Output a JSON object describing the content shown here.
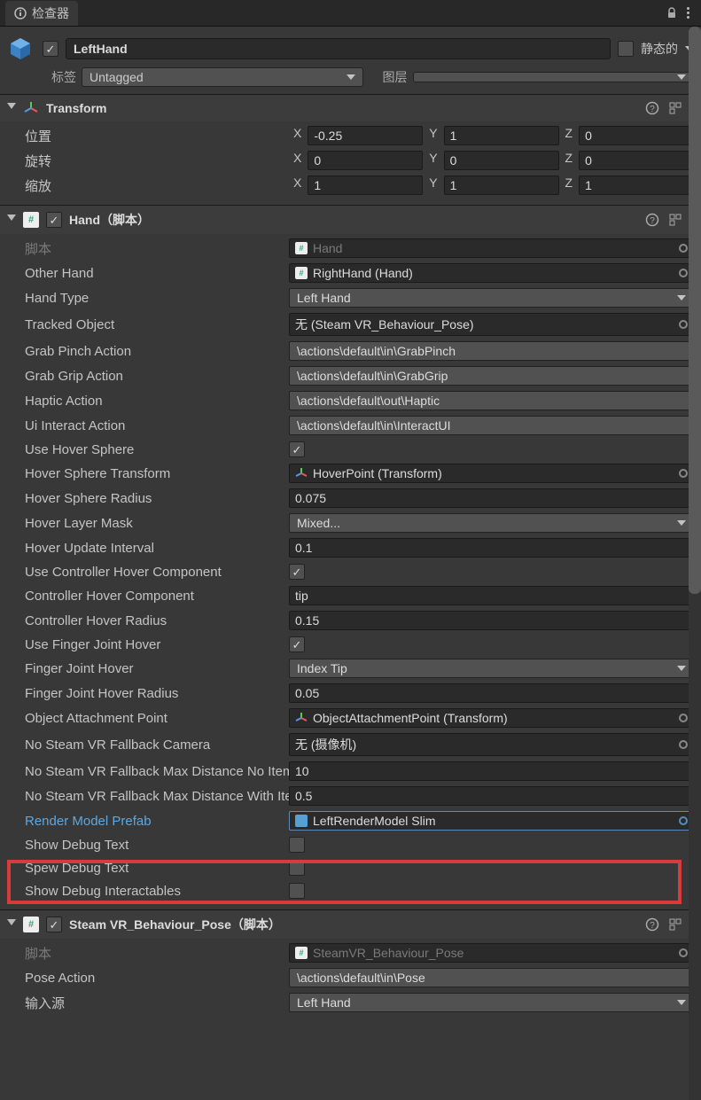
{
  "tab": {
    "title": "检查器"
  },
  "header": {
    "name": "LeftHand",
    "static_label": "静态的"
  },
  "tag_row": {
    "tag_label": "标签",
    "tag_value": "Untagged",
    "layer_label": "图层",
    "layer_value": ""
  },
  "transform": {
    "title": "Transform",
    "position_label": "位置",
    "rotation_label": "旋转",
    "scale_label": "缩放",
    "pos": {
      "x": "-0.25",
      "y": "1",
      "z": "0"
    },
    "rot": {
      "x": "0",
      "y": "0",
      "z": "0"
    },
    "scale": {
      "x": "1",
      "y": "1",
      "z": "1"
    },
    "axis": {
      "x": "X",
      "y": "Y",
      "z": "Z"
    }
  },
  "hand": {
    "title": "Hand（脚本）",
    "script_label": "脚本",
    "script_value": "Hand",
    "other_hand_label": "Other Hand",
    "other_hand_value": "RightHand (Hand)",
    "hand_type_label": "Hand Type",
    "hand_type_value": "Left Hand",
    "tracked_object_label": "Tracked Object",
    "tracked_object_value": "无 (Steam VR_Behaviour_Pose)",
    "grab_pinch_label": "Grab Pinch Action",
    "grab_pinch_value": "\\actions\\default\\in\\GrabPinch",
    "grab_grip_label": "Grab Grip Action",
    "grab_grip_value": "\\actions\\default\\in\\GrabGrip",
    "haptic_label": "Haptic Action",
    "haptic_value": "\\actions\\default\\out\\Haptic",
    "ui_interact_label": "Ui Interact Action",
    "ui_interact_value": "\\actions\\default\\in\\InteractUI",
    "use_hover_sphere_label": "Use Hover Sphere",
    "hover_sphere_transform_label": "Hover Sphere Transform",
    "hover_sphere_transform_value": "HoverPoint (Transform)",
    "hover_sphere_radius_label": "Hover Sphere Radius",
    "hover_sphere_radius_value": "0.075",
    "hover_layer_mask_label": "Hover Layer Mask",
    "hover_layer_mask_value": "Mixed...",
    "hover_update_interval_label": "Hover Update Interval",
    "hover_update_interval_value": "0.1",
    "use_controller_hover_label": "Use Controller Hover Component",
    "controller_hover_comp_label": "Controller Hover Component",
    "controller_hover_comp_value": "tip",
    "controller_hover_radius_label": "Controller Hover Radius",
    "controller_hover_radius_value": "0.15",
    "use_finger_joint_hover_label": "Use Finger Joint Hover",
    "finger_joint_hover_label": "Finger Joint Hover",
    "finger_joint_hover_value": "Index Tip",
    "finger_joint_hover_radius_label": "Finger Joint Hover Radius",
    "finger_joint_hover_radius_value": "0.05",
    "object_attachment_label": "Object Attachment Point",
    "object_attachment_value": "ObjectAttachmentPoint (Transform)",
    "no_steamvr_fallback_cam_label": "No Steam VR Fallback Camera",
    "no_steamvr_fallback_cam_value": "无 (摄像机)",
    "no_steamvr_fallback_max1_label": "No Steam VR Fallback Max Distance No Item",
    "no_steamvr_fallback_max1_value": "10",
    "no_steamvr_fallback_max2_label": "No Steam VR Fallback Max Distance With Item",
    "no_steamvr_fallback_max2_value": "0.5",
    "render_model_prefab_label": "Render Model Prefab",
    "render_model_prefab_value": "LeftRenderModel Slim",
    "show_debug_text_label": "Show Debug Text",
    "spew_debug_text_label": "Spew Debug Text",
    "show_debug_interactables_label": "Show Debug Interactables"
  },
  "pose": {
    "title": "Steam VR_Behaviour_Pose（脚本）",
    "script_label": "脚本",
    "script_value": "SteamVR_Behaviour_Pose",
    "pose_action_label": "Pose Action",
    "pose_action_value": "\\actions\\default\\in\\Pose",
    "input_source_label": "输入源",
    "input_source_value": "Left Hand"
  }
}
